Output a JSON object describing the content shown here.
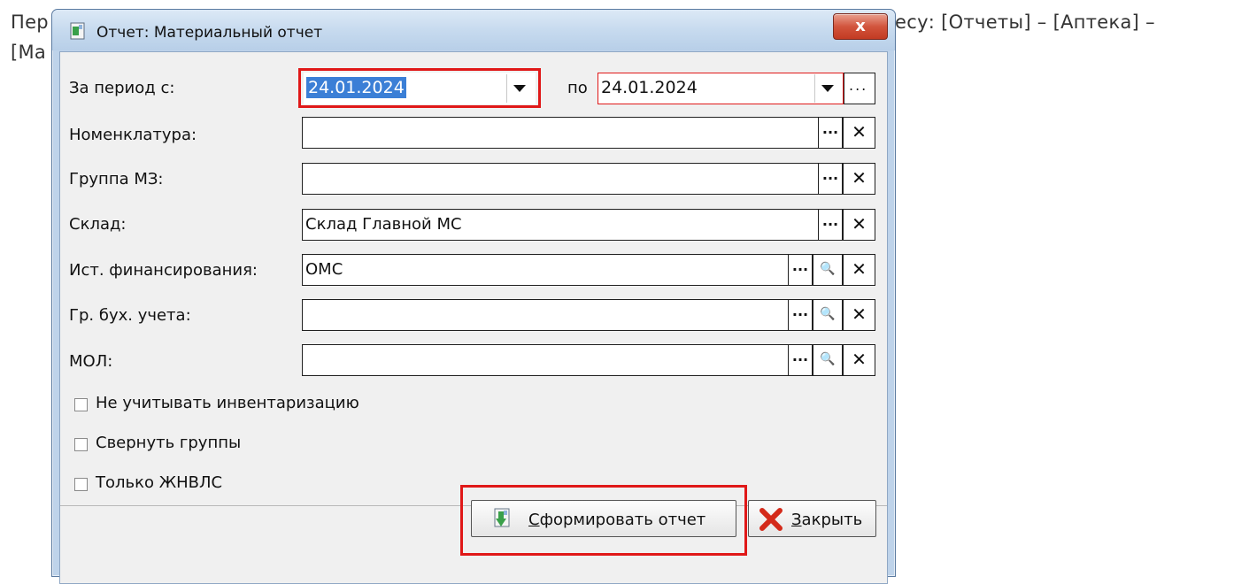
{
  "background": {
    "line1_left": "Пер",
    "line1_right": "есу: [Отчеты] – [Аптека] –",
    "line2_left": "[Ма"
  },
  "window": {
    "title": "Отчет: Материальный отчет",
    "close_glyph": "x"
  },
  "period": {
    "label": "За период с:",
    "from_value": "24.01.2024",
    "to_label": "по",
    "to_value": "24.01.2024",
    "more_glyph": "..."
  },
  "fields": {
    "nomenclature": {
      "label": "Номенклатура:",
      "value": ""
    },
    "mz_group": {
      "label": "Группа МЗ:",
      "value": ""
    },
    "warehouse": {
      "label": "Склад:",
      "value": "Склад Главной МС"
    },
    "finance_source": {
      "label": "Ист. финансирования:",
      "value": "ОМС"
    },
    "accounting_group": {
      "label": "Гр. бух. учета:",
      "value": ""
    },
    "mol": {
      "label": "МОЛ:",
      "value": ""
    }
  },
  "glyphs": {
    "ellipsis": "···",
    "clear": "✕",
    "search": "🔍"
  },
  "checkboxes": {
    "skip_inventory": {
      "label": "Не учитывать инвентаризацию",
      "checked": false
    },
    "collapse_groups": {
      "label": "Свернуть группы",
      "checked": false
    },
    "only_zhnvls": {
      "label": "Только ЖНВЛС",
      "checked": false
    }
  },
  "buttons": {
    "generate": {
      "label_first": "С",
      "label_rest": "формировать отчет"
    },
    "close": {
      "label_first": "З",
      "label_rest": "акрыть"
    }
  },
  "colors": {
    "highlight_border": "#e01818",
    "selection": "#3b7fd6",
    "close_icon_red": "#d42a1a"
  }
}
